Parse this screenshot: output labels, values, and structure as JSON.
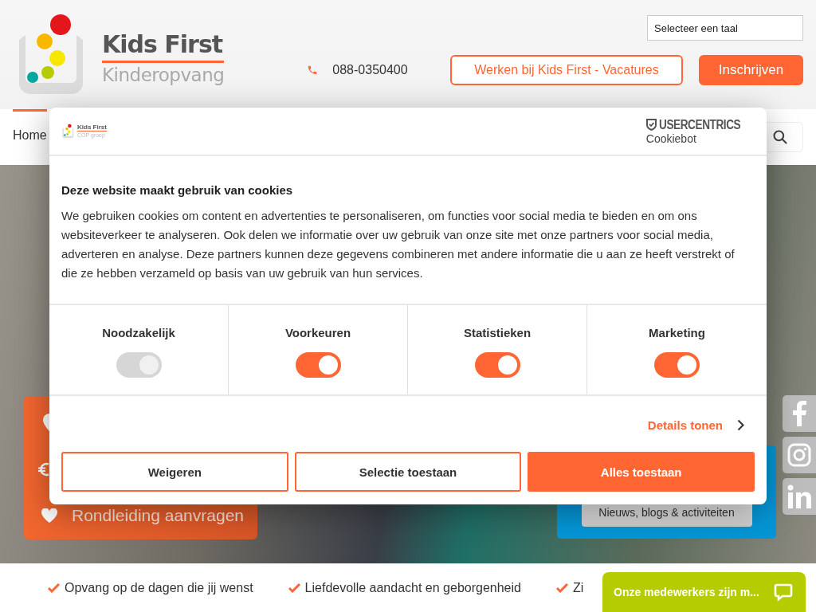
{
  "header": {
    "logo": {
      "name": "Kids First",
      "tagline": "Kinderopvang"
    },
    "language_select": {
      "value": "Selecteer een taal"
    },
    "phone": "088-0350400",
    "buttons": [
      {
        "label": "Werken bij Kids First - Vacatures",
        "kind": "outline"
      },
      {
        "label": "Inschrijven",
        "kind": "filled"
      }
    ]
  },
  "nav": {
    "items": [
      {
        "label": "Home",
        "selected": true
      }
    ]
  },
  "hero": {
    "orange_panel": {
      "items": [
        {
          "label": "Rondleiding aanvragen"
        }
      ]
    },
    "blue_panel": {
      "button": "Nieuws, blogs & activiteiten"
    }
  },
  "features": [
    "Opvang op de dagen die jij wenst",
    "Liefdevolle aandacht en geborgenheid",
    "Zi"
  ],
  "chat": {
    "label": "Onze medewerkers zijn m..."
  },
  "cookie_dialog": {
    "logo": {
      "name": "Kids First",
      "sub": "COP groep"
    },
    "provider": {
      "name": "USERCENTRICS",
      "product": "Cookiebot"
    },
    "title": "Deze website maakt gebruik van cookies",
    "body": "We gebruiken cookies om content en advertenties te personaliseren, om functies voor social media te bieden en om ons websiteverkeer te analyseren. Ook delen we informatie over uw gebruik van onze site met onze partners voor social media, adverteren en analyse. Deze partners kunnen deze gegevens combineren met andere informatie die u aan ze heeft verstrekt of die ze hebben verzameld op basis van uw gebruik van hun services.",
    "categories": [
      {
        "label": "Noodzakelijk",
        "on": true,
        "disabled": true
      },
      {
        "label": "Voorkeuren",
        "on": true,
        "disabled": false
      },
      {
        "label": "Statistieken",
        "on": true,
        "disabled": false
      },
      {
        "label": "Marketing",
        "on": true,
        "disabled": false
      }
    ],
    "details_link": "Details tonen",
    "buttons": [
      {
        "label": "Weigeren",
        "kind": "outline"
      },
      {
        "label": "Selectie toestaan",
        "kind": "outline"
      },
      {
        "label": "Alles toestaan",
        "kind": "filled"
      }
    ]
  }
}
